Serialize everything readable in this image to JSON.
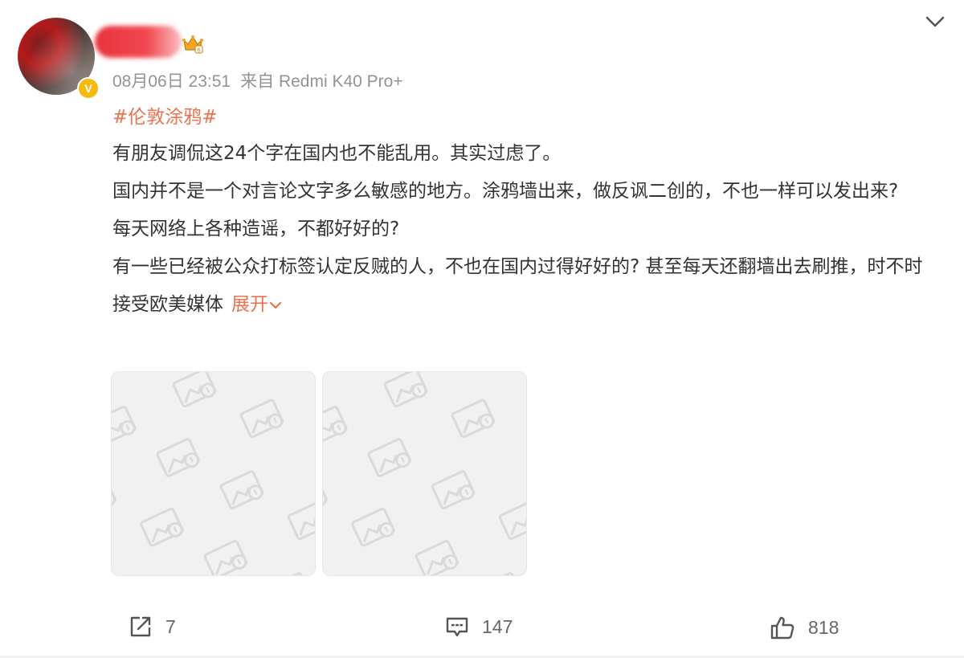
{
  "post": {
    "meta": {
      "date": "08月06日 23:51",
      "source": "来自 Redmi K40 Pro+"
    },
    "hashtag": "#伦敦涂鸦#",
    "paragraphs": [
      "有朋友调侃这24个字在国内也不能乱用。其实过虑了。",
      "国内并不是一个对言论文字多么敏感的地方。涂鸦墙出来，做反讽二创的，不也一样可以发出来?",
      "每天网络上各种造谣，不都好好的?",
      "有一些已经被公众打标签认定反贼的人，不也在国内过得好好的? 甚至每天还翻墙出去刷推，时不时接受欧美媒体"
    ],
    "expand_label": "展开",
    "verified_badge": "V",
    "image_count": 2
  },
  "actions": {
    "share_count": "7",
    "comment_count": "147",
    "like_count": "818"
  },
  "icons": [
    "chevron-down-icon",
    "vip-crown-icon",
    "verified-icon",
    "share-icon",
    "comment-icon",
    "like-icon",
    "image-placeholder-icon"
  ],
  "colors": {
    "accent": "#eb7350",
    "meta": "#939393",
    "text": "#333333",
    "badge": "#f5b90f"
  }
}
